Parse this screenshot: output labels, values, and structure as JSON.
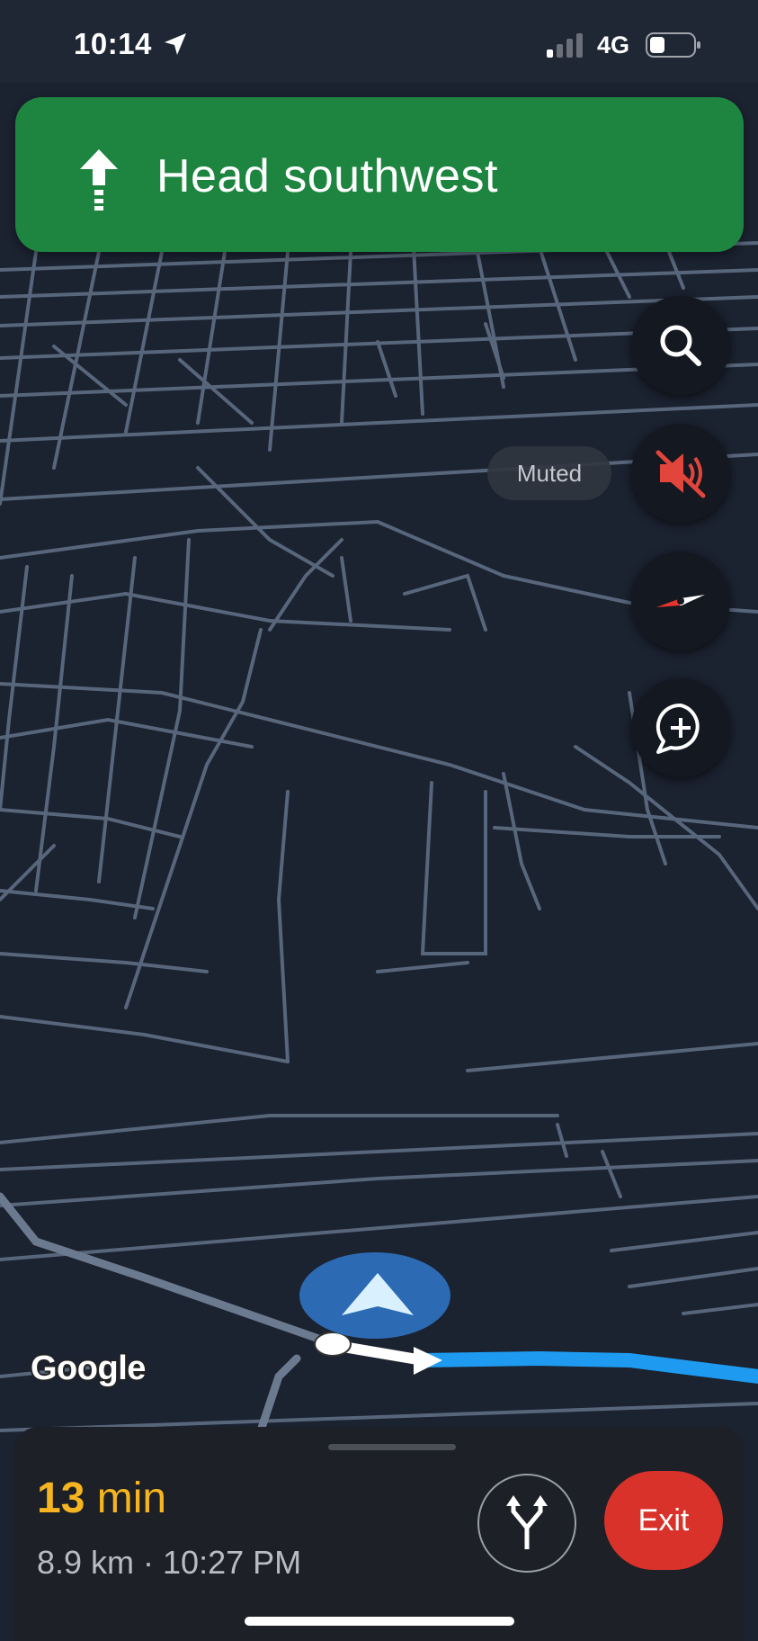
{
  "status_bar": {
    "time": "10:14",
    "network": "4G",
    "icons": [
      "location-arrow-icon",
      "cellular-signal-icon",
      "battery-icon"
    ]
  },
  "banner": {
    "instruction": "Head southwest",
    "icon": "straight-arrow-icon",
    "color": "#1e8540"
  },
  "map_controls": {
    "search_icon": "search-icon",
    "mute_icon": "sound-muted-icon",
    "muted_label": "Muted",
    "compass_icon": "compass-icon",
    "report_icon": "add-report-icon"
  },
  "map": {
    "attribution": "Google",
    "route_color": "#1e9bf0",
    "position_icon": "navigation-arrow-icon"
  },
  "trip": {
    "duration_value": "13",
    "duration_unit": "min",
    "details": "8.9 km · 10:27 PM",
    "alt_routes_icon": "alternate-routes-icon",
    "exit_label": "Exit",
    "eta_color": "#f6b520",
    "exit_color": "#d8322a"
  }
}
